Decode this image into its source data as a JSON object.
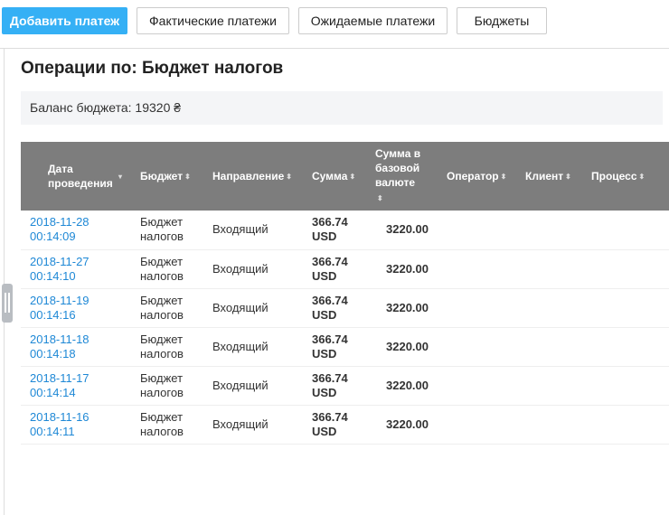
{
  "toolbar": {
    "add_payment": "Добавить платеж",
    "actual_payments": "Фактические платежи",
    "expected_payments": "Ожидаемые платежи",
    "budgets": "Бюджеты"
  },
  "page_title": "Операции по: Бюджет налогов",
  "balance": "Баланс бюджета: 19320 ₴",
  "table": {
    "headers": [
      "Дата проведения",
      "Бюджет",
      "Направление",
      "Сумма",
      "Сумма в базовой валюте",
      "Оператор",
      "Клиент",
      "Процесс"
    ],
    "rows": [
      {
        "date": "2018-11-28",
        "time": "00:14:09",
        "budget": "Бюджет налогов",
        "direction": "Входящий",
        "amount": "366.74",
        "currency": "USD",
        "base": "3220.00"
      },
      {
        "date": "2018-11-27",
        "time": "00:14:10",
        "budget": "Бюджет налогов",
        "direction": "Входящий",
        "amount": "366.74",
        "currency": "USD",
        "base": "3220.00"
      },
      {
        "date": "2018-11-19",
        "time": "00:14:16",
        "budget": "Бюджет налогов",
        "direction": "Входящий",
        "amount": "366.74",
        "currency": "USD",
        "base": "3220.00"
      },
      {
        "date": "2018-11-18",
        "time": "00:14:18",
        "budget": "Бюджет налогов",
        "direction": "Входящий",
        "amount": "366.74",
        "currency": "USD",
        "base": "3220.00"
      },
      {
        "date": "2018-11-17",
        "time": "00:14:14",
        "budget": "Бюджет налогов",
        "direction": "Входящий",
        "amount": "366.74",
        "currency": "USD",
        "base": "3220.00"
      },
      {
        "date": "2018-11-16",
        "time": "00:14:11",
        "budget": "Бюджет налогов",
        "direction": "Входящий",
        "amount": "366.74",
        "currency": "USD",
        "base": "3220.00"
      }
    ]
  }
}
